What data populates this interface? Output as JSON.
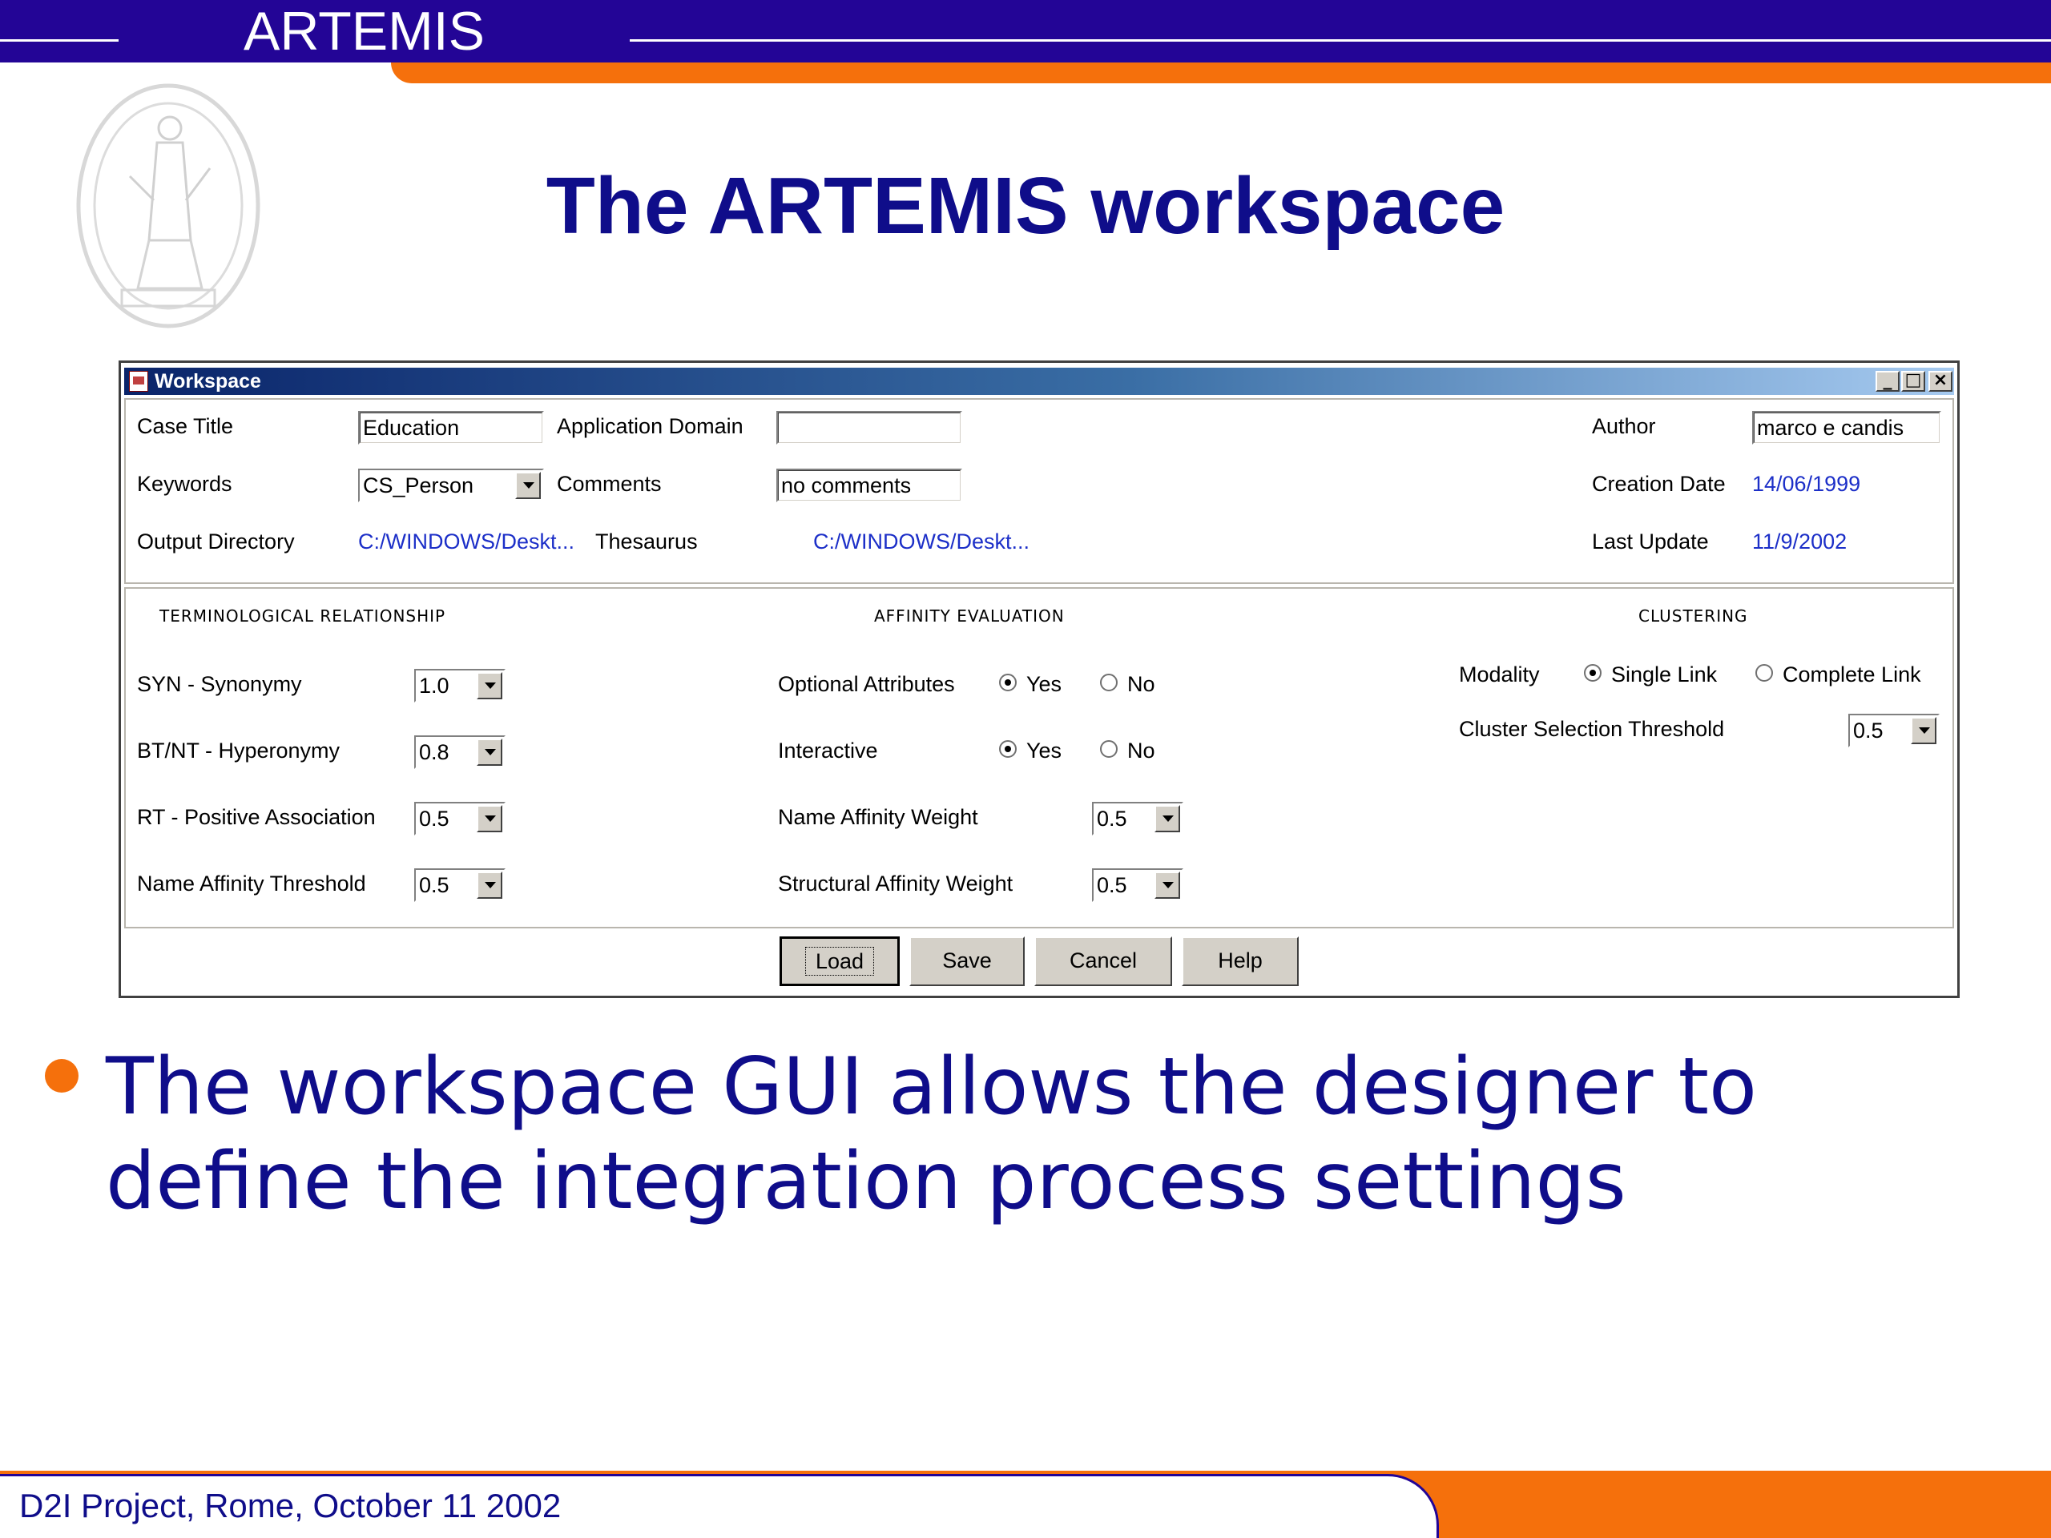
{
  "slide": {
    "brand": "ARTEMIS",
    "title": "The ARTEMIS workspace",
    "bullet": "The workspace GUI allows the designer to define the integration process settings",
    "footer": "D2I Project, Rome, October 11 2002",
    "colors": {
      "navy": "#230596",
      "orange": "#f5700c",
      "text_blue": "#0f0d8a"
    }
  },
  "window": {
    "title": "Workspace",
    "icon": "java-cup-icon",
    "controls": {
      "minimize": "_",
      "maximize": "□",
      "close": "×"
    }
  },
  "general": {
    "case_title_label": "Case Title",
    "case_title_value": "Education",
    "app_domain_label": "Application Domain",
    "app_domain_value": "",
    "author_label": "Author",
    "author_value": "marco e candis",
    "keywords_label": "Keywords",
    "keywords_value": "CS_Person",
    "comments_label": "Comments",
    "comments_value": "no comments",
    "creation_date_label": "Creation Date",
    "creation_date_value": "14/06/1999",
    "output_dir_label": "Output Directory",
    "output_dir_value": "C:/WINDOWS/Deskt...",
    "thesaurus_label": "Thesaurus",
    "thesaurus_value": "C:/WINDOWS/Deskt...",
    "last_update_label": "Last Update",
    "last_update_value": "11/9/2002"
  },
  "terminological": {
    "heading": "TERMINOLOGICAL RELATIONSHIP",
    "rows": [
      {
        "label": "SYN - Synonymy",
        "value": "1.0"
      },
      {
        "label": "BT/NT - Hyperonymy",
        "value": "0.8"
      },
      {
        "label": "RT - Positive Association",
        "value": "0.5"
      },
      {
        "label": "Name Affinity Threshold",
        "value": "0.5"
      }
    ]
  },
  "affinity": {
    "heading": "AFFINITY EVALUATION",
    "optional_label": "Optional Attributes",
    "interactive_label": "Interactive",
    "yes": "Yes",
    "no": "No",
    "optional_selected": "Yes",
    "interactive_selected": "Yes",
    "name_weight_label": "Name Affinity Weight",
    "name_weight_value": "0.5",
    "struct_weight_label": "Structural Affinity Weight",
    "struct_weight_value": "0.5"
  },
  "clustering": {
    "heading": "CLUSTERING",
    "modality_label": "Modality",
    "single_link": "Single Link",
    "complete_link": "Complete Link",
    "modality_selected": "Single Link",
    "threshold_label": "Cluster Selection Threshold",
    "threshold_value": "0.5"
  },
  "buttons": {
    "load": "Load",
    "save": "Save",
    "cancel": "Cancel",
    "help": "Help"
  }
}
